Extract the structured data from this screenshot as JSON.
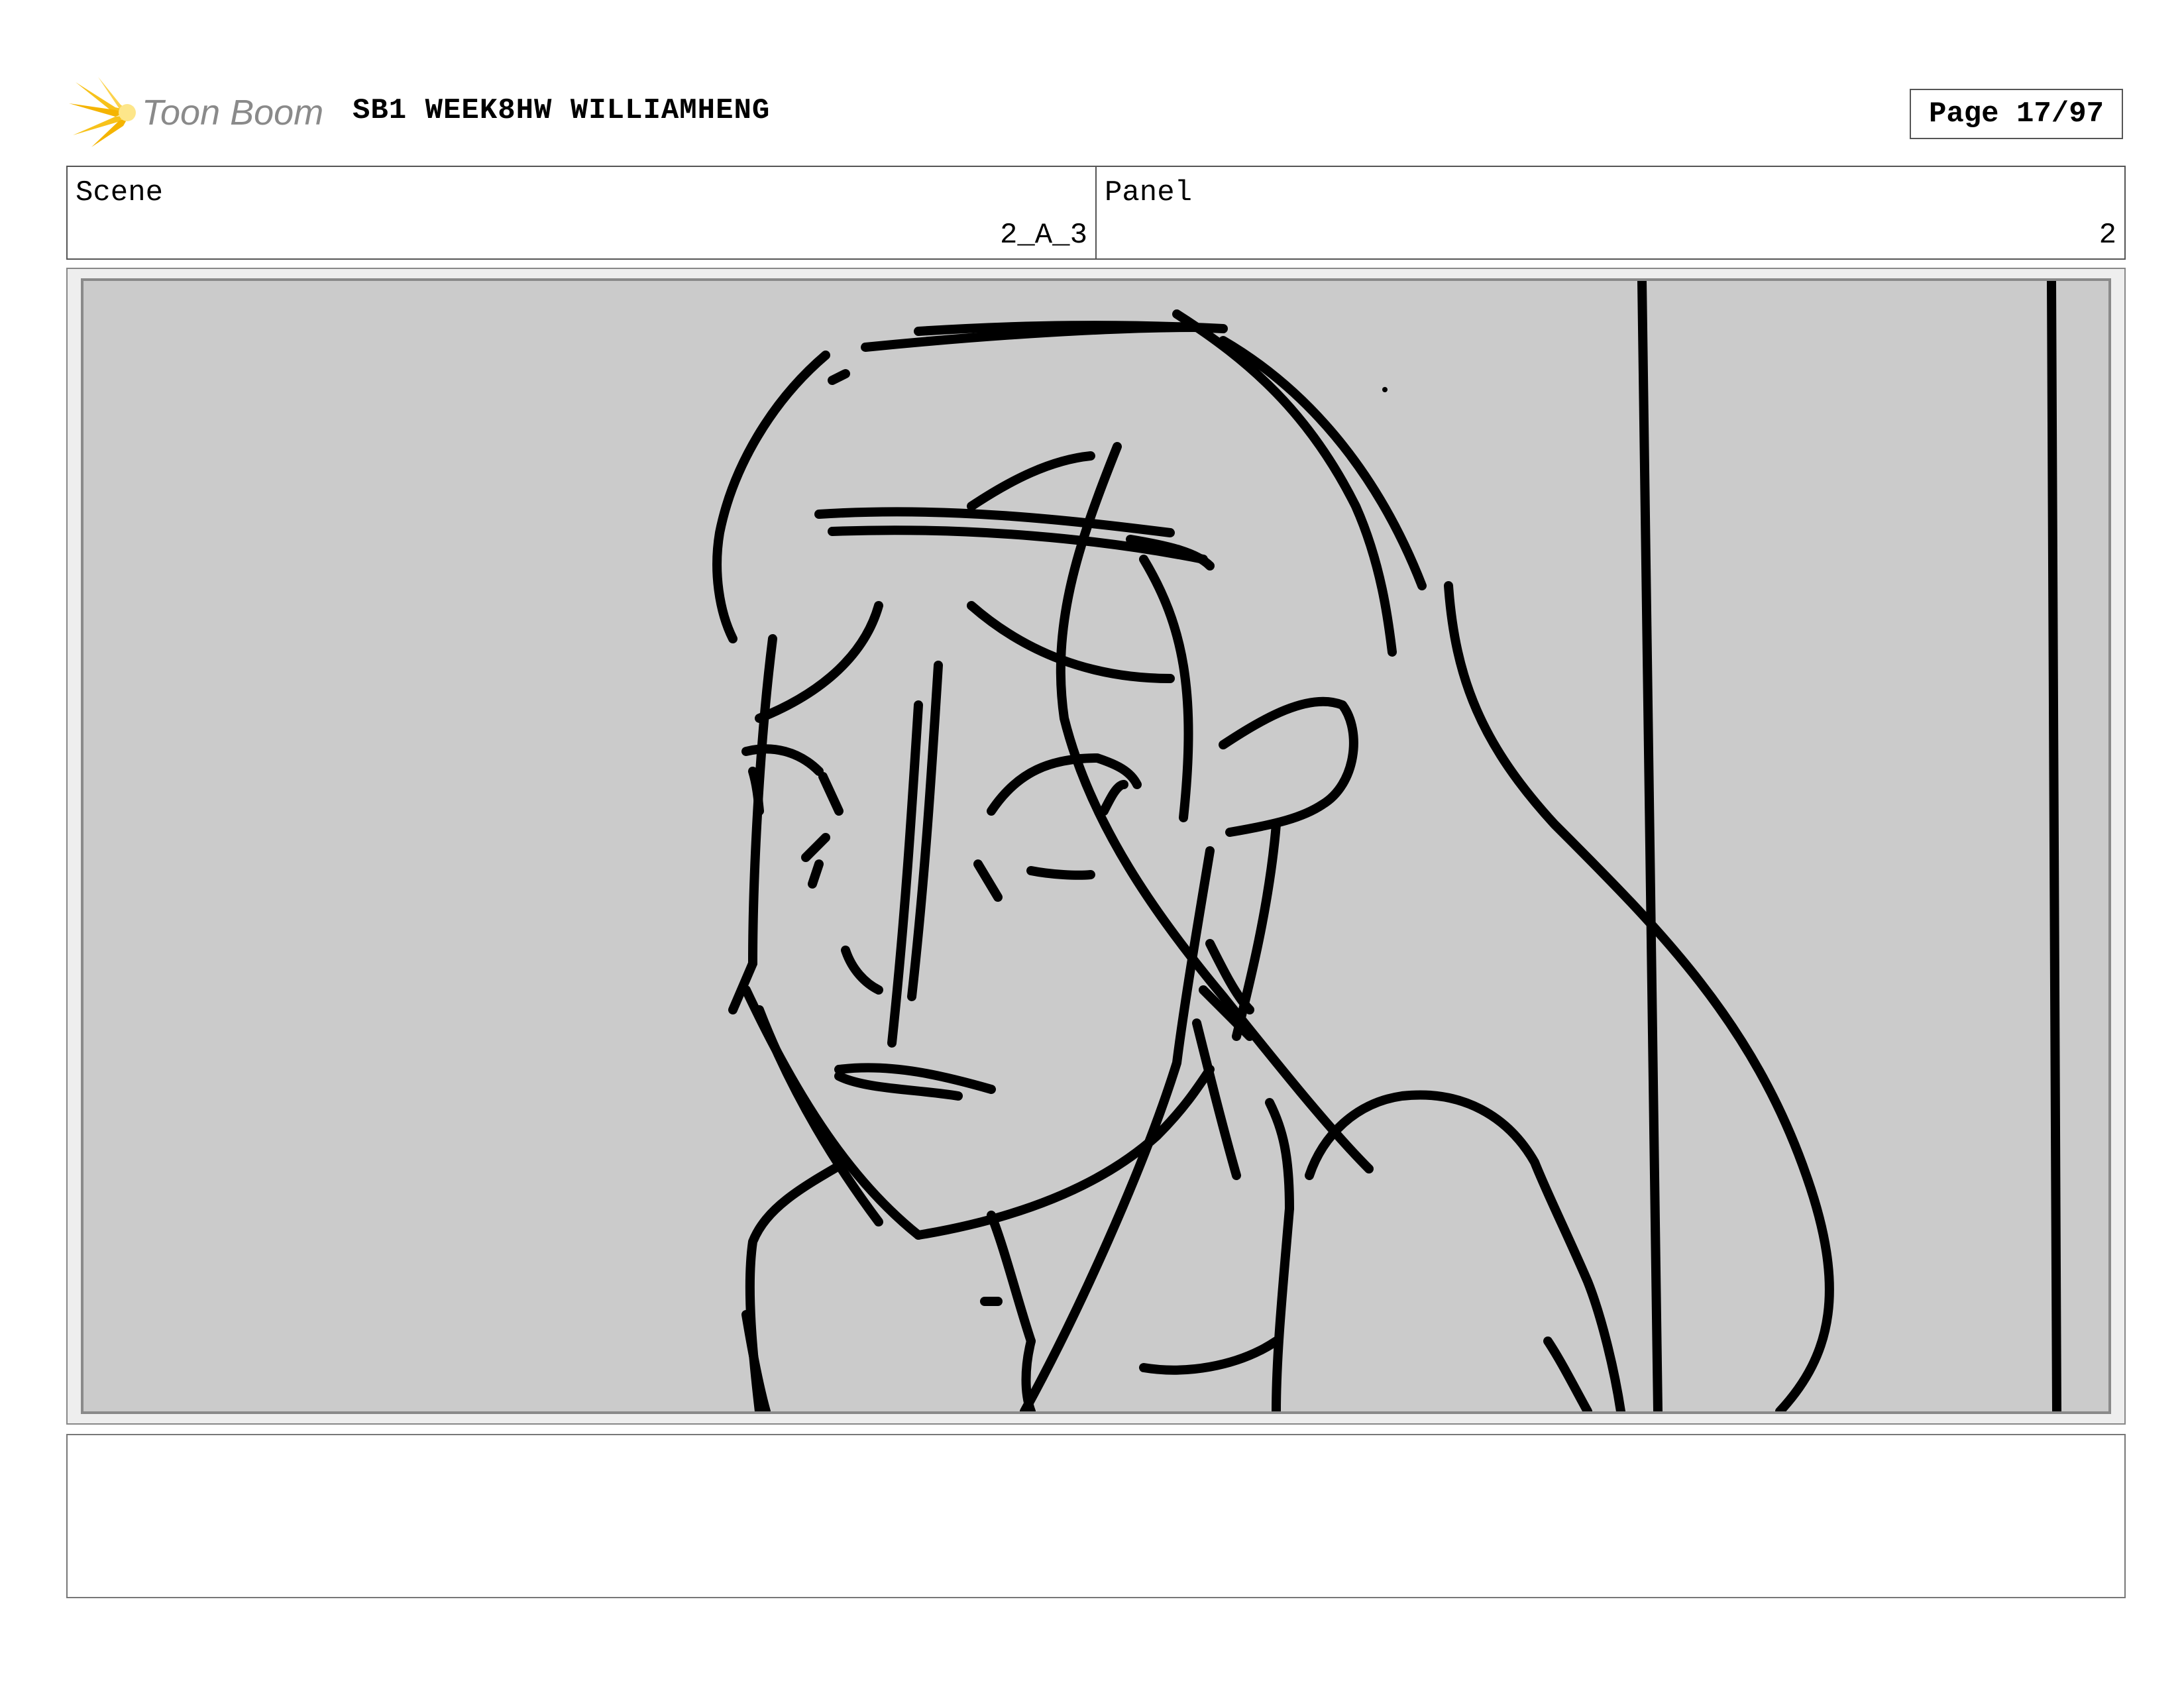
{
  "header": {
    "logo_text": "Toon Boom",
    "title": "SB1 WEEK8HW WILLIAMHENG",
    "page": "Page 17/97"
  },
  "scene": {
    "label": "Scene",
    "value": "2_A_3"
  },
  "panel": {
    "label": "Panel",
    "value": "2"
  },
  "notes": {
    "text": ""
  },
  "colors": {
    "logo_yellow": "#f7c21b",
    "logo_gray": "#8a8a8a",
    "panel_bg": "#cbcbcb",
    "stroke": "#000000"
  }
}
